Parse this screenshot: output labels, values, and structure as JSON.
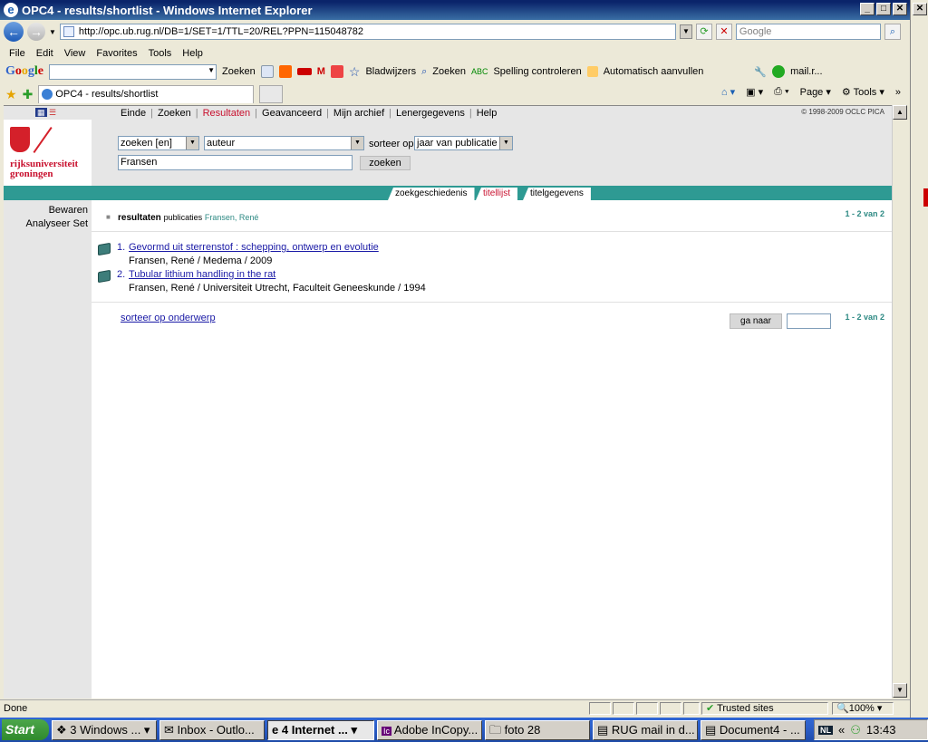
{
  "window": {
    "title": "OPC4 - results/shortlist - Windows Internet Explorer"
  },
  "address": {
    "url": "http://opc.ub.rug.nl/DB=1/SET=1/TTL=20/REL?PPN=115048782",
    "search_placeholder": "Google"
  },
  "menu": [
    "File",
    "Edit",
    "View",
    "Favorites",
    "Tools",
    "Help"
  ],
  "google_toolbar": {
    "zoeken": "Zoeken",
    "bladwijzers": "Bladwijzers",
    "zoeken2": "Zoeken",
    "spelling": "Spelling controleren",
    "auto": "Automatisch aanvullen",
    "mail": "mail.r..."
  },
  "tab": {
    "label": "OPC4 - results/shortlist"
  },
  "tabtools": {
    "page": "Page",
    "tools": "Tools"
  },
  "site": {
    "nav": [
      "Einde",
      "Zoeken",
      "Resultaten",
      "Geavanceerd",
      "Mijn archief",
      "Lenergegevens",
      "Help"
    ],
    "copyright": "© 1998-2009 OCLC PICA",
    "logo_line1": "rijksuniversiteit",
    "logo_line2": "groningen",
    "search": {
      "scope": "zoeken [en]",
      "field": "auteur",
      "sort_label": "sorteer op",
      "sort": "jaar van publicatie",
      "query": "Fransen",
      "button": "zoeken"
    },
    "tabs": [
      "zoekgeschiedenis",
      "titellijst",
      "titelgegevens"
    ],
    "side": [
      "Bewaren",
      "Analyseer Set"
    ],
    "results_label": "resultaten",
    "results_type": "publicaties",
    "results_query": "Fransen, René",
    "count": "1 - 2 van 2",
    "results": [
      {
        "num": "1.",
        "title": "Gevormd uit sterrenstof : schepping, ontwerp en evolutie",
        "meta": "Fransen, René / Medema / 2009"
      },
      {
        "num": "2.",
        "title": "Tubular lithium handling in the rat",
        "meta": "Fransen, René / Universiteit Utrecht, Faculteit Geneeskunde / 1994"
      }
    ],
    "sort_subject": "sorteer op onderwerp",
    "goto": "ga naar",
    "count_bottom": "1 - 2 van 2"
  },
  "status": {
    "text": "Done",
    "zone": "Trusted sites",
    "zoom": "100%"
  },
  "taskbar": {
    "start": "Start",
    "items": [
      "3 Windows ...",
      "Inbox - Outlo...",
      "4 Internet ...",
      "Adobe InCopy...",
      "foto 28",
      "RUG mail in d...",
      "Document4 - ..."
    ],
    "lang": "NL",
    "clock": "13:43"
  }
}
